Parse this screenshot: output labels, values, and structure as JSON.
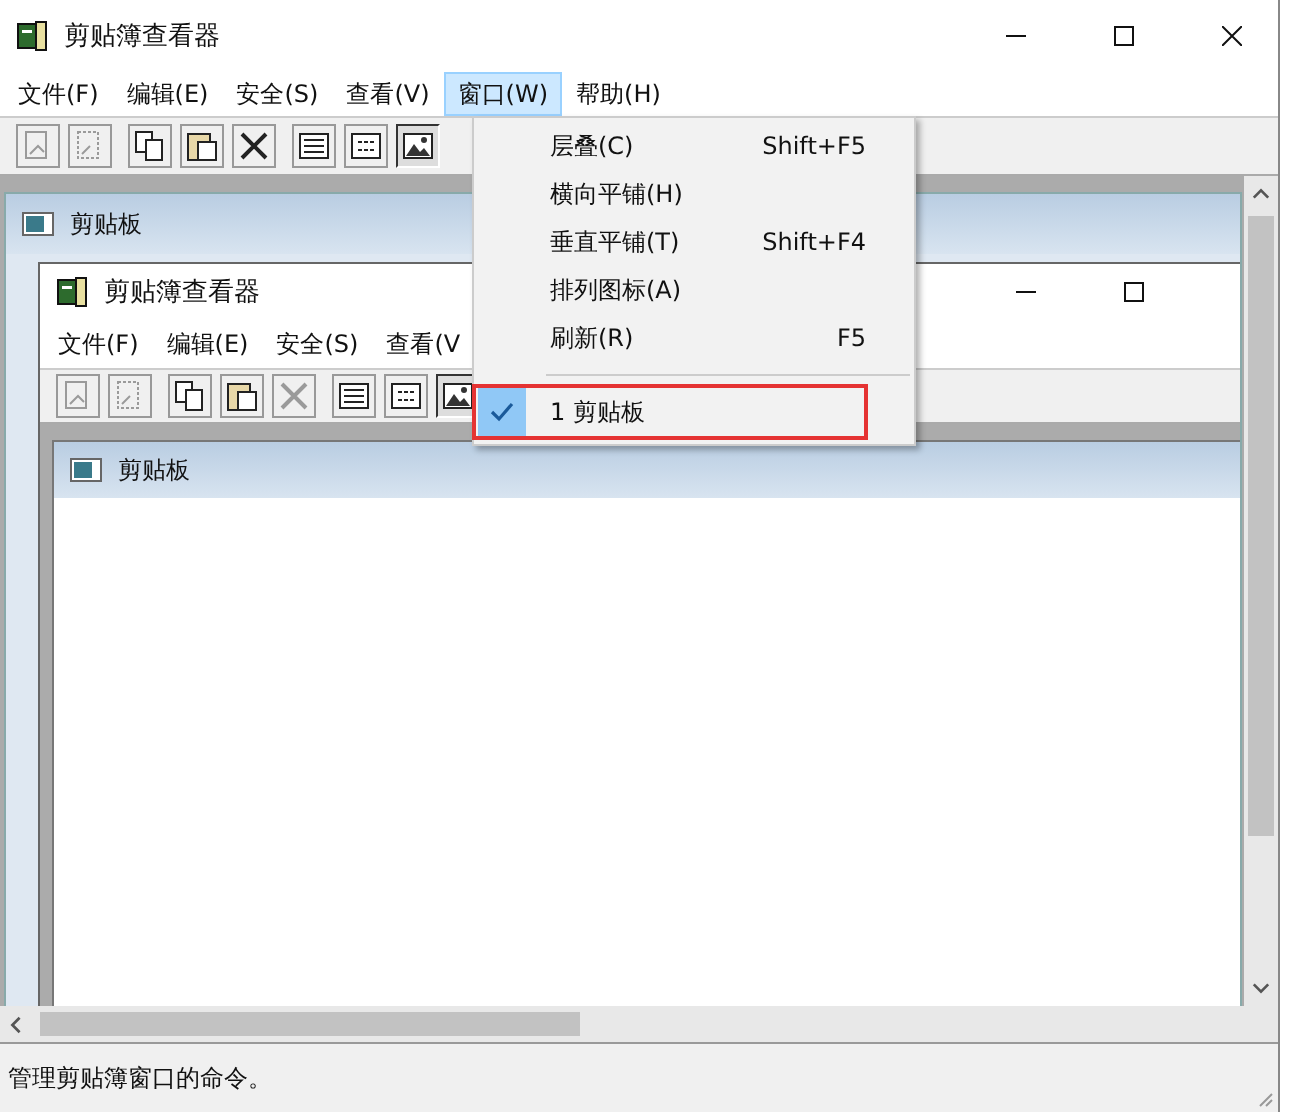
{
  "window": {
    "title": "剪贴簿查看器"
  },
  "menu_bar": [
    {
      "label": "文件(F)",
      "selected": false
    },
    {
      "label": "编辑(E)",
      "selected": false
    },
    {
      "label": "安全(S)",
      "selected": false
    },
    {
      "label": "查看(V)",
      "selected": false
    },
    {
      "label": "窗口(W)",
      "selected": true
    },
    {
      "label": "帮助(H)",
      "selected": false
    }
  ],
  "toolbar": [
    [
      {
        "disabled": true,
        "pressed": false
      },
      {
        "disabled": true,
        "pressed": false
      }
    ],
    [
      {
        "disabled": false,
        "pressed": false
      },
      {
        "disabled": false,
        "pressed": false
      },
      {
        "disabled": false,
        "pressed": false
      }
    ],
    [
      {
        "disabled": false,
        "pressed": false
      },
      {
        "disabled": false,
        "pressed": false
      },
      {
        "disabled": false,
        "pressed": true
      }
    ]
  ],
  "mdi_child": {
    "title": "剪贴板"
  },
  "inner_window": {
    "title": "剪贴簿查看器",
    "menu_bar": [
      {
        "label": "文件(F)",
        "selected": false
      },
      {
        "label": "编辑(E)",
        "selected": false
      },
      {
        "label": "安全(S)",
        "selected": false
      },
      {
        "label": "查看(V",
        "selected": false
      }
    ],
    "toolbar": [
      [
        {
          "disabled": true,
          "pressed": false
        },
        {
          "disabled": true,
          "pressed": false
        }
      ],
      [
        {
          "disabled": false,
          "pressed": false
        },
        {
          "disabled": false,
          "pressed": false
        },
        {
          "disabled": true,
          "pressed": false
        }
      ],
      [
        {
          "disabled": false,
          "pressed": false
        },
        {
          "disabled": false,
          "pressed": false
        },
        {
          "disabled": false,
          "pressed": true
        }
      ]
    ],
    "child": {
      "title": "剪贴板"
    }
  },
  "dropdown": [
    {
      "kind": "item",
      "label": "层叠(C)",
      "shortcut": "Shift+F5",
      "checked": false,
      "outlined": false
    },
    {
      "kind": "item",
      "label": "横向平铺(H)",
      "checked": false,
      "outlined": false
    },
    {
      "kind": "item",
      "label": "垂直平铺(T)",
      "shortcut": "Shift+F4",
      "checked": false,
      "outlined": false
    },
    {
      "kind": "item",
      "label": "排列图标(A)",
      "checked": false,
      "outlined": false
    },
    {
      "kind": "item",
      "label": "刷新(R)",
      "shortcut": "F5",
      "checked": false,
      "outlined": false
    },
    {
      "kind": "separator"
    },
    {
      "kind": "item",
      "label": "1 剪贴板",
      "checked": true,
      "outlined": true
    }
  ],
  "status_bar": "管理剪贴簿窗口的命令。"
}
